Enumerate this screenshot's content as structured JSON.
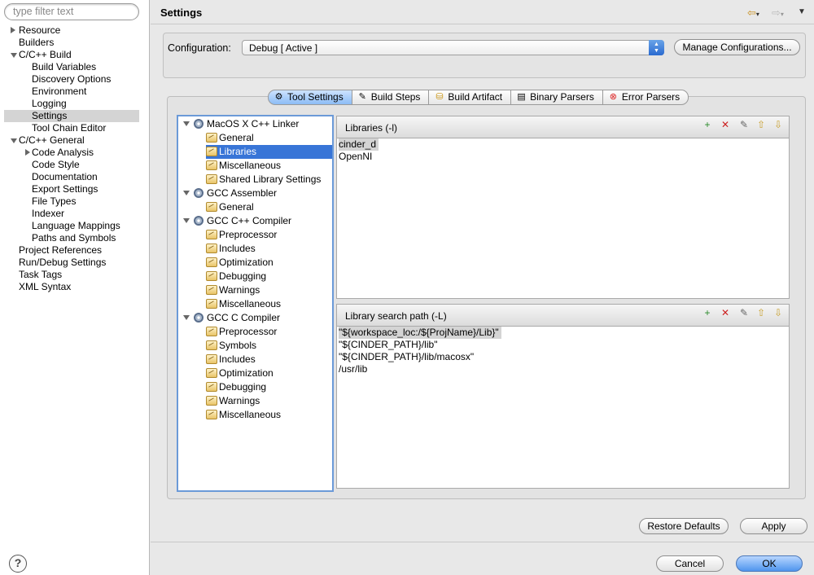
{
  "filter": {
    "placeholder": "type filter text"
  },
  "nav": [
    {
      "label": "Resource",
      "indent": 1,
      "toggle": "r"
    },
    {
      "label": "Builders",
      "indent": 1,
      "toggle": ""
    },
    {
      "label": "C/C++ Build",
      "indent": 1,
      "toggle": "d"
    },
    {
      "label": "Build Variables",
      "indent": 3,
      "toggle": ""
    },
    {
      "label": "Discovery Options",
      "indent": 3,
      "toggle": ""
    },
    {
      "label": "Environment",
      "indent": 3,
      "toggle": ""
    },
    {
      "label": "Logging",
      "indent": 3,
      "toggle": ""
    },
    {
      "label": "Settings",
      "indent": 3,
      "toggle": "",
      "selected": true
    },
    {
      "label": "Tool Chain Editor",
      "indent": 3,
      "toggle": ""
    },
    {
      "label": "C/C++ General",
      "indent": 1,
      "toggle": "d"
    },
    {
      "label": "Code Analysis",
      "indent": 3,
      "toggle": "r"
    },
    {
      "label": "Code Style",
      "indent": 3,
      "toggle": ""
    },
    {
      "label": "Documentation",
      "indent": 3,
      "toggle": ""
    },
    {
      "label": "Export Settings",
      "indent": 3,
      "toggle": ""
    },
    {
      "label": "File Types",
      "indent": 3,
      "toggle": ""
    },
    {
      "label": "Indexer",
      "indent": 3,
      "toggle": ""
    },
    {
      "label": "Language Mappings",
      "indent": 3,
      "toggle": ""
    },
    {
      "label": "Paths and Symbols",
      "indent": 3,
      "toggle": ""
    },
    {
      "label": "Project References",
      "indent": 1,
      "toggle": ""
    },
    {
      "label": "Run/Debug Settings",
      "indent": 1,
      "toggle": ""
    },
    {
      "label": "Task Tags",
      "indent": 1,
      "toggle": ""
    },
    {
      "label": "XML Syntax",
      "indent": 1,
      "toggle": ""
    }
  ],
  "help": "?",
  "header": {
    "title": "Settings"
  },
  "config": {
    "label": "Configuration:",
    "value": "Debug  [ Active ]",
    "manage": "Manage Configurations..."
  },
  "tabs": [
    {
      "label": "Tool Settings",
      "icon": "tool-settings-icon",
      "glyph": "⚙",
      "active": true
    },
    {
      "label": "Build Steps",
      "icon": "build-steps-icon",
      "glyph": "✎"
    },
    {
      "label": "Build Artifact",
      "icon": "build-artifact-icon",
      "glyph": "⛁"
    },
    {
      "label": "Binary Parsers",
      "icon": "binary-parsers-icon",
      "glyph": "▤"
    },
    {
      "label": "Error Parsers",
      "icon": "error-parsers-icon",
      "glyph": "⊗"
    }
  ],
  "tree": [
    {
      "label": "MacOS X C++ Linker",
      "type": "tool"
    },
    {
      "label": "General",
      "type": "opt"
    },
    {
      "label": "Libraries",
      "type": "opt",
      "selected": true
    },
    {
      "label": "Miscellaneous",
      "type": "opt"
    },
    {
      "label": "Shared Library Settings",
      "type": "opt"
    },
    {
      "label": "GCC Assembler",
      "type": "tool"
    },
    {
      "label": "General",
      "type": "opt"
    },
    {
      "label": "GCC C++ Compiler",
      "type": "tool"
    },
    {
      "label": "Preprocessor",
      "type": "opt"
    },
    {
      "label": "Includes",
      "type": "opt"
    },
    {
      "label": "Optimization",
      "type": "opt"
    },
    {
      "label": "Debugging",
      "type": "opt"
    },
    {
      "label": "Warnings",
      "type": "opt"
    },
    {
      "label": "Miscellaneous",
      "type": "opt"
    },
    {
      "label": "GCC C Compiler",
      "type": "tool"
    },
    {
      "label": "Preprocessor",
      "type": "opt"
    },
    {
      "label": "Symbols",
      "type": "opt"
    },
    {
      "label": "Includes",
      "type": "opt"
    },
    {
      "label": "Optimization",
      "type": "opt"
    },
    {
      "label": "Debugging",
      "type": "opt"
    },
    {
      "label": "Warnings",
      "type": "opt"
    },
    {
      "label": "Miscellaneous",
      "type": "opt"
    }
  ],
  "libraries": {
    "title": "Libraries (-l)",
    "items": [
      "cinder_d",
      "OpenNI"
    ]
  },
  "search_paths": {
    "title": "Library search path (-L)",
    "items": [
      "\"${workspace_loc:/${ProjName}/Lib}\"",
      "\"${CINDER_PATH}/lib\"",
      "\"${CINDER_PATH}/lib/macosx\"",
      "/usr/lib"
    ]
  },
  "list_tools": [
    {
      "name": "add-icon",
      "glyph": "+",
      "color": "#2a8a2a"
    },
    {
      "name": "delete-icon",
      "glyph": "✕",
      "color": "#c22"
    },
    {
      "name": "edit-icon",
      "glyph": "✎",
      "color": "#666"
    },
    {
      "name": "move-up-icon",
      "glyph": "⇧",
      "color": "#c8a030"
    },
    {
      "name": "move-down-icon",
      "glyph": "⇩",
      "color": "#c8a030"
    }
  ],
  "buttons": {
    "restore": "Restore Defaults",
    "apply": "Apply",
    "cancel": "Cancel",
    "ok": "OK"
  }
}
